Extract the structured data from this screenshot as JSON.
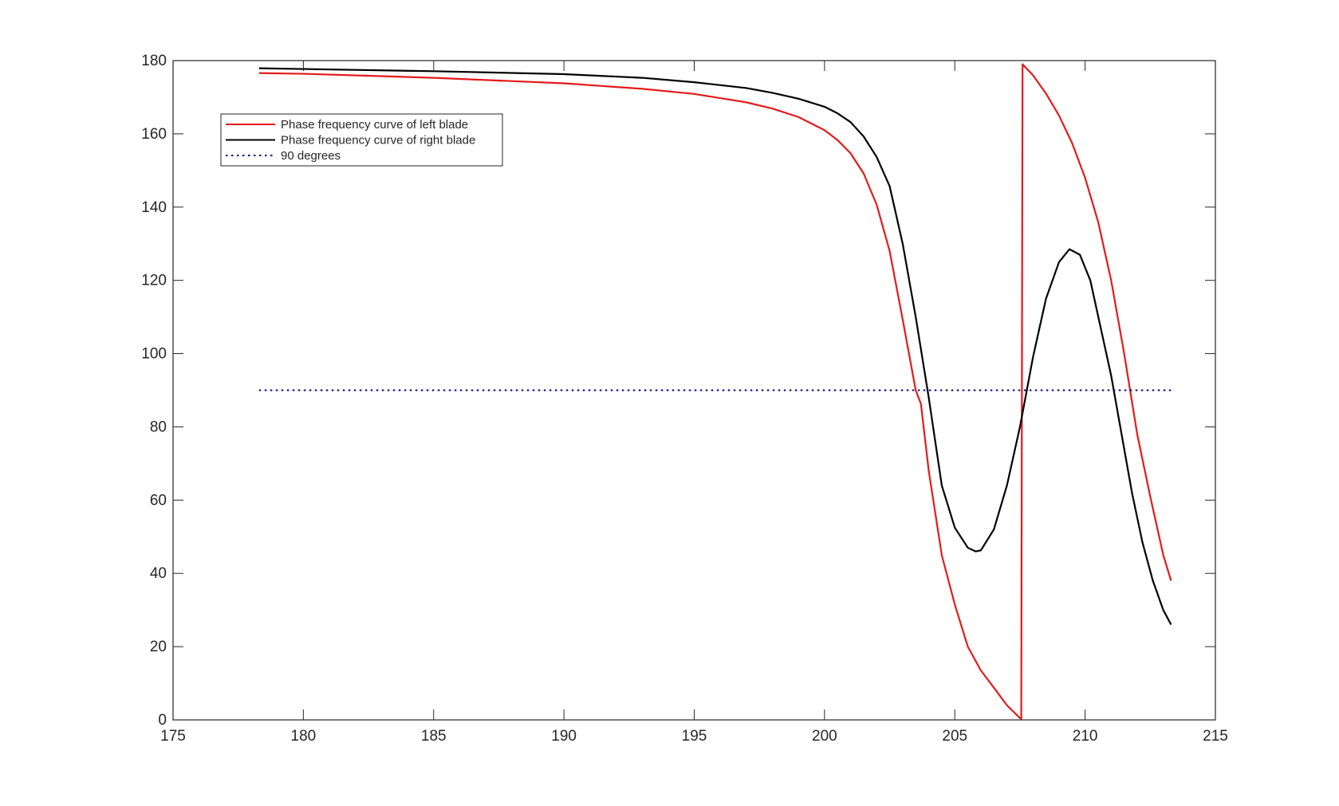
{
  "chart_data": {
    "type": "line",
    "xlim": [
      175,
      215
    ],
    "ylim": [
      0,
      180
    ],
    "xticks": [
      175,
      180,
      185,
      190,
      195,
      200,
      205,
      210,
      215
    ],
    "yticks": [
      0,
      20,
      40,
      60,
      80,
      100,
      120,
      140,
      160,
      180
    ],
    "grid": false,
    "legend_position": "top-left",
    "series": [
      {
        "name": "Phase frequency curve of left blade",
        "color": "#e41a1c",
        "style": "solid",
        "x": [
          178.3,
          180,
          185,
          190,
          193,
          195,
          197,
          198,
          199,
          200,
          200.5,
          201,
          201.5,
          202,
          202.5,
          203,
          203.5,
          203.7,
          204,
          204.5,
          205,
          205.5,
          206,
          206.5,
          207,
          207.5,
          207.55,
          207.6,
          208,
          208.5,
          209,
          209.5,
          210,
          210.5,
          211,
          211.5,
          212,
          212.5,
          213,
          213.3
        ],
        "y": [
          176.6,
          176.4,
          175.3,
          173.8,
          172.3,
          170.9,
          168.6,
          166.9,
          164.6,
          161.0,
          158.3,
          154.7,
          149.2,
          140.7,
          128.0,
          109.3,
          90.0,
          86.3,
          68.0,
          45.0,
          31.5,
          20.0,
          13.5,
          8.8,
          4.0,
          0.5,
          0.3,
          179.0,
          176.0,
          171.0,
          165.0,
          157.5,
          148.0,
          136.0,
          120.0,
          100.0,
          78.0,
          61.0,
          45.0,
          38.0
        ]
      },
      {
        "name": "Phase frequency curve of right blade",
        "color": "#000000",
        "style": "solid",
        "x": [
          178.3,
          180,
          185,
          190,
          193,
          195,
          197,
          198,
          199,
          200,
          200.5,
          201,
          201.5,
          202,
          202.5,
          203,
          203.5,
          204,
          204.5,
          205,
          205.5,
          205.8,
          206,
          206.5,
          207,
          207.5,
          208,
          208.5,
          209,
          209.4,
          209.8,
          210.2,
          210.6,
          211,
          211.4,
          211.8,
          212.2,
          212.6,
          213,
          213.3
        ],
        "y": [
          177.9,
          177.7,
          177.1,
          176.3,
          175.3,
          174.1,
          172.5,
          171.2,
          169.6,
          167.4,
          165.6,
          163.2,
          159.3,
          153.7,
          145.7,
          130.0,
          110.0,
          88.0,
          64.0,
          52.5,
          47.0,
          46.0,
          46.3,
          52.0,
          64.0,
          80.0,
          99.0,
          115.0,
          125.0,
          128.5,
          127.0,
          120.0,
          107.0,
          94.0,
          78.0,
          62.0,
          48.5,
          38.0,
          30.0,
          26.0
        ]
      },
      {
        "name": "90 degrees",
        "color": "#00008b",
        "style": "dotted",
        "x": [
          178.3,
          213.3
        ],
        "y": [
          90,
          90
        ]
      }
    ]
  }
}
